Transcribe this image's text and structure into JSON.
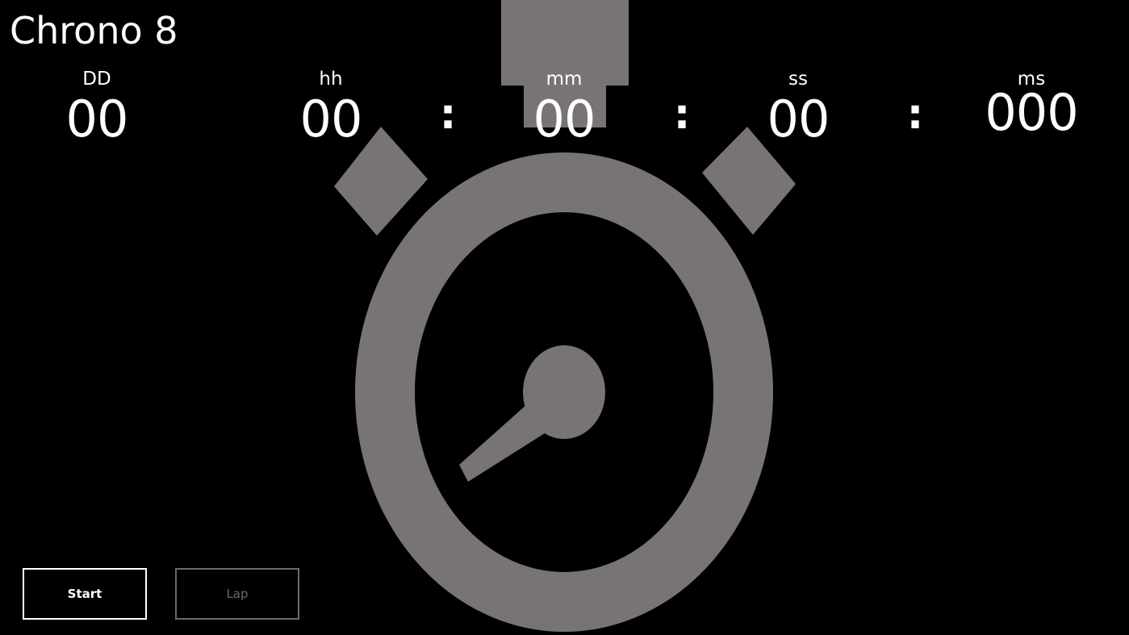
{
  "app": {
    "title": "Chrono 8"
  },
  "timer": {
    "units": [
      {
        "label": "DD",
        "value": "00"
      },
      {
        "label": "hh",
        "value": "00"
      },
      {
        "label": "mm",
        "value": "00"
      },
      {
        "label": "ss",
        "value": "00"
      },
      {
        "label": "ms",
        "value": "000"
      }
    ],
    "separator": ":"
  },
  "buttons": {
    "start_label": "Start",
    "lap_label": "Lap"
  },
  "colors": {
    "background": "#000000",
    "watch_graphic": "#787474",
    "text": "#ffffff",
    "disabled": "#6a6a6a"
  },
  "icons": {
    "background_graphic": "stopwatch-icon"
  }
}
